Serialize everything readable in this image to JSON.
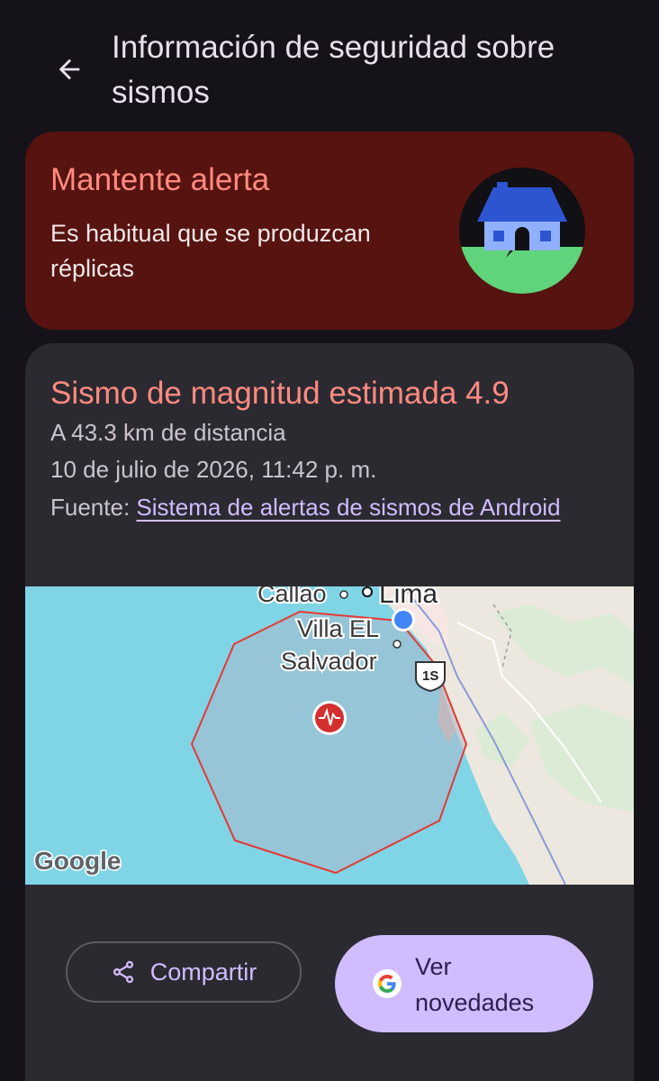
{
  "header": {
    "title": "Información de seguridad sobre sismos"
  },
  "alert": {
    "title": "Mantente alerta",
    "description": "Es habitual que se produzcan réplicas"
  },
  "quake": {
    "title": "Sismo de magnitud estimada 4.9",
    "distance": "A 43.3 km de distancia",
    "datetime": "10 de julio de 2026, 11:42 p. m.",
    "source_prefix": "Fuente: ",
    "source_link": "Sistema de alertas de sismos de Android"
  },
  "map": {
    "labels": {
      "callao": "Callao",
      "lima": "Lima",
      "villa_1": "Villa EL",
      "villa_2": "Salvador",
      "route": "1S"
    },
    "attribution": "Google"
  },
  "actions": {
    "share_label": "Compartir",
    "news_label": "Ver novedades"
  },
  "colors": {
    "background": "#151319",
    "alert_card": "#561310",
    "alert_text": "#ff8a80",
    "card": "#2b2a31",
    "accent": "#d0bcff",
    "ocean": "#7fd5e6",
    "zone_stroke": "#e53935"
  },
  "icons": [
    "back-arrow-icon",
    "house-quake-icon",
    "quake-epicenter-icon",
    "share-icon",
    "google-g-icon",
    "user-location-icon"
  ]
}
